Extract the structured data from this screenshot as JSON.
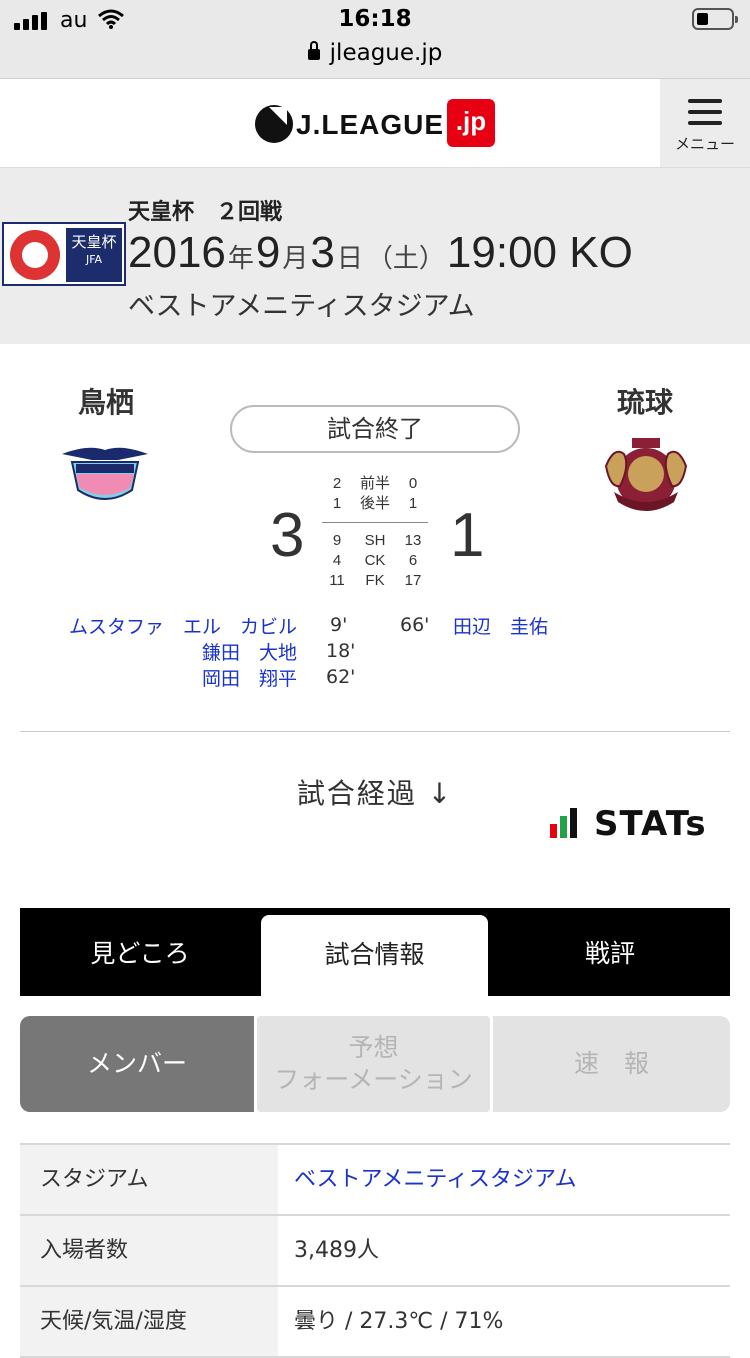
{
  "status_bar": {
    "carrier": "au",
    "time": "16:18",
    "url": "jleague.jp"
  },
  "header": {
    "logo_text": "J.LEAGUE",
    "logo_suffix": ".jp",
    "menu_label": "メニュー"
  },
  "match": {
    "competition": "天皇杯　２回戦",
    "cup_badge": [
      "天皇杯",
      "JFA"
    ],
    "kickoff": {
      "year": "2016",
      "year_unit": "年",
      "month": "9",
      "month_unit": "月",
      "day": "3",
      "day_unit": "日",
      "weekday": "（土）",
      "time": "19:00 KO"
    },
    "venue": "ベストアメニティスタジアム"
  },
  "scoreboard": {
    "home_team": "鳥栖",
    "away_team": "琉球",
    "status": "試合終了",
    "home_score": "3",
    "away_score": "1",
    "halves": [
      {
        "home": "2",
        "label": "前半",
        "away": "0"
      },
      {
        "home": "1",
        "label": "後半",
        "away": "1"
      }
    ],
    "stats": [
      {
        "home": "9",
        "label": "SH",
        "away": "13"
      },
      {
        "home": "4",
        "label": "CK",
        "away": "6"
      },
      {
        "home": "11",
        "label": "FK",
        "away": "17"
      }
    ],
    "home_goals": [
      {
        "scorer": "ムスタファ　エル　カビル",
        "minute": "9'"
      },
      {
        "scorer": "鎌田　大地",
        "minute": "18'"
      },
      {
        "scorer": "岡田　翔平",
        "minute": "62'"
      }
    ],
    "away_goals": [
      {
        "minute": "66'",
        "scorer": "田辺　圭佑"
      }
    ]
  },
  "progress_link": "試合経過 ↓",
  "stats_brand": "STATs",
  "tabs": [
    "見どころ",
    "試合情報",
    "戦評"
  ],
  "active_tab": "試合情報",
  "subtabs": [
    {
      "label": "メンバー"
    },
    {
      "label_line1": "予想",
      "label_line2": "フォーメーション"
    },
    {
      "label": "速　報"
    }
  ],
  "info_table": [
    {
      "key": "スタジアム",
      "value": "ベストアメニティスタジアム",
      "is_link": true
    },
    {
      "key": "入場者数",
      "value": "3,489人",
      "is_link": false
    },
    {
      "key": "天候/気温/湿度",
      "value": "曇り / 27.3℃ / 71%",
      "is_link": false
    }
  ],
  "colors": {
    "link": "#1a33cc",
    "accent_red": "#e60012",
    "tab_bar": "#000000"
  }
}
